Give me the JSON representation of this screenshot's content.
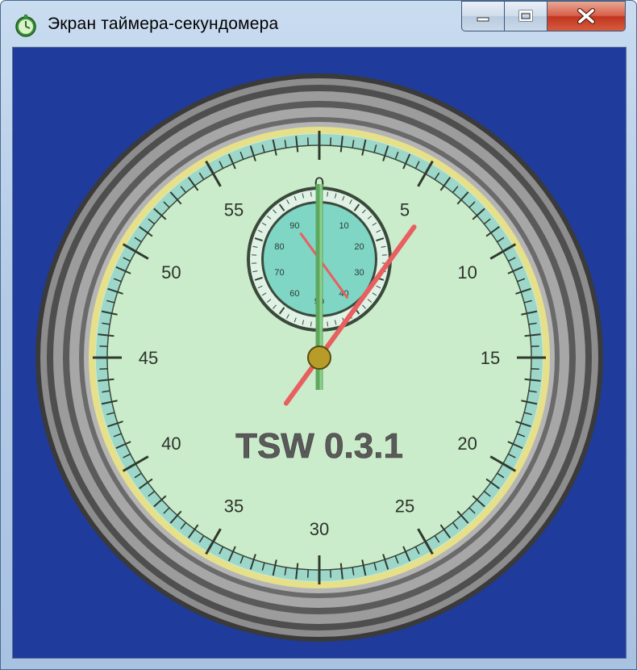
{
  "window": {
    "title": "Экран таймера-секундомера",
    "icons": {
      "app": "stopwatch-icon",
      "minimize": "minimize-icon",
      "maximize": "maximize-icon",
      "close": "close-icon"
    }
  },
  "stopwatch": {
    "app_label": "TSW 0.3.1",
    "main_dial_numbers": [
      "0",
      "5",
      "10",
      "15",
      "20",
      "25",
      "30",
      "35",
      "40",
      "45",
      "50",
      "55"
    ],
    "sub_dial_numbers": [
      "0",
      "10",
      "20",
      "30",
      "40",
      "50",
      "60",
      "70",
      "80",
      "90"
    ],
    "hands": {
      "seconds": 6,
      "minutes_hand": 0,
      "subdial_hand": 4
    }
  },
  "colors": {
    "background": "#1f3b9c",
    "face": "#cbeccb",
    "subdial": "#7fd6c4",
    "rim": "#9c9c9c",
    "yellow_ring": "#e6e08a",
    "red_hand": "#e85f5f",
    "green_hand": "#5ea85e",
    "hub": "#b79c2a"
  }
}
